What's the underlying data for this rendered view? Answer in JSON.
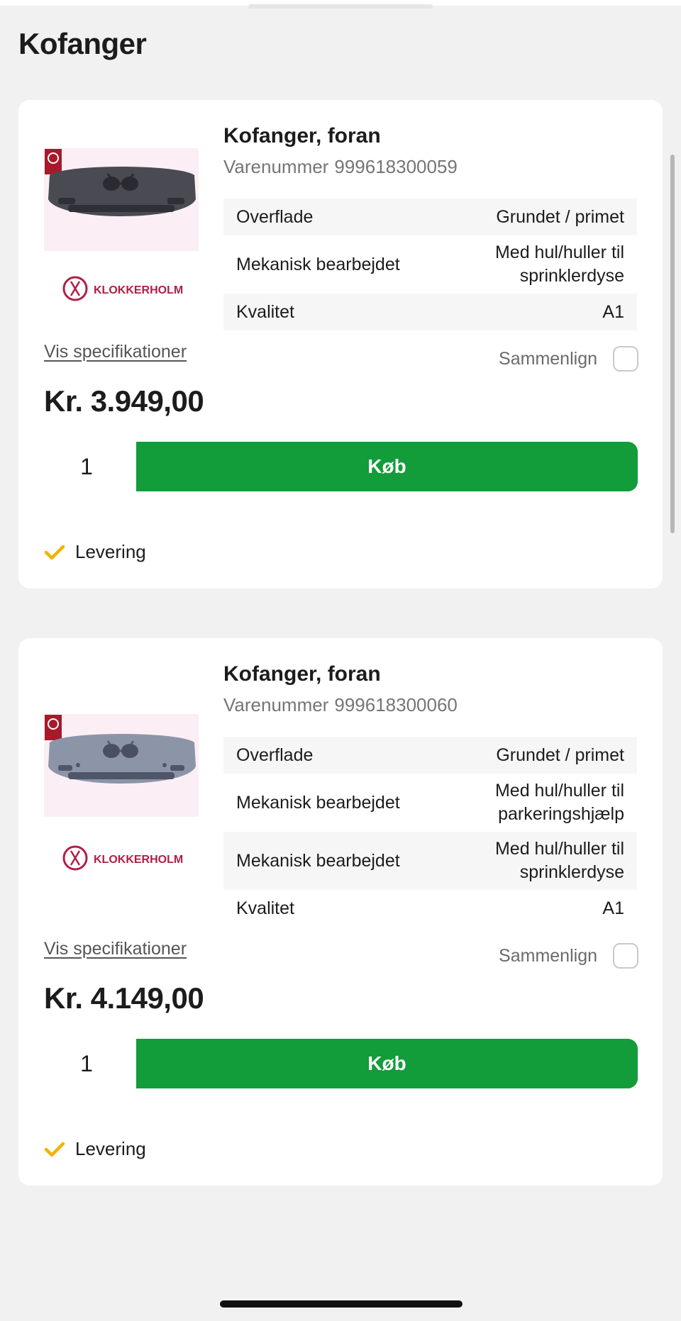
{
  "page": {
    "title": "Kofanger"
  },
  "products": [
    {
      "title": "Kofanger, foran",
      "sku_label": "Varenummer",
      "sku": "999618300059",
      "brand": "KLOKKERHOLM",
      "specs": [
        {
          "label": "Overflade",
          "value": "Grundet / primet"
        },
        {
          "label": "Mekanisk bearbejdet",
          "value_lines": [
            "Med hul/huller til",
            "sprinklerdyse"
          ]
        },
        {
          "label": "Kvalitet",
          "value": "A1"
        }
      ],
      "spec_link": "Vis specifikationer",
      "compare_label": "Sammenlign",
      "compare_checked": false,
      "price": "Kr. 3.949,00",
      "quantity": "1",
      "buy_label": "Køb",
      "delivery_label": "Levering",
      "image_color": "#4a4a52"
    },
    {
      "title": "Kofanger, foran",
      "sku_label": "Varenummer",
      "sku": "999618300060",
      "brand": "KLOKKERHOLM",
      "specs": [
        {
          "label": "Overflade",
          "value": "Grundet / primet"
        },
        {
          "label": "Mekanisk bearbejdet",
          "value_lines": [
            "Med hul/huller til",
            "parkeringshjælp"
          ]
        },
        {
          "label": "Mekanisk bearbejdet",
          "value_lines": [
            "Med hul/huller til",
            "sprinklerdyse"
          ]
        },
        {
          "label": "Kvalitet",
          "value": "A1"
        }
      ],
      "spec_link": "Vis specifikationer",
      "compare_label": "Sammenlign",
      "compare_checked": false,
      "price": "Kr. 4.149,00",
      "quantity": "1",
      "buy_label": "Køb",
      "delivery_label": "Levering",
      "image_color": "#8c95a8"
    }
  ],
  "colors": {
    "buy_button": "#139c3a",
    "check_icon": "#f2b300",
    "brand": "#b21e45",
    "background": "#f1f1f1"
  }
}
